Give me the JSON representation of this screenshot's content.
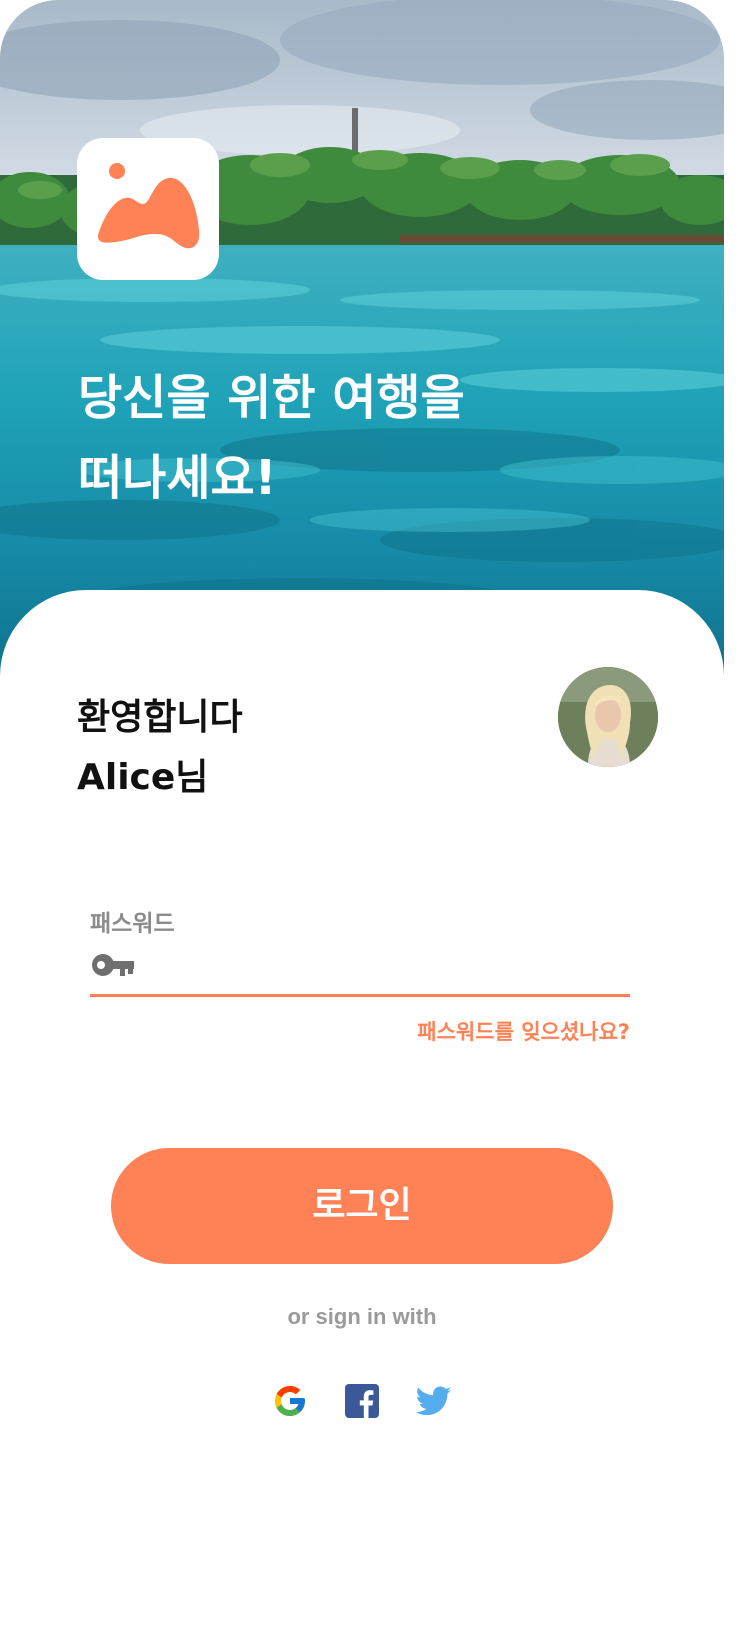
{
  "hero": {
    "title_line1": "당신을 위한 여행을",
    "title_line2": "떠나세요!"
  },
  "welcome": {
    "line1": "환영합니다",
    "line2": "Alice님"
  },
  "password_field": {
    "label": "패스워드",
    "value": "",
    "icon": "key-icon"
  },
  "forgot_password": "패스워드를 잊으셨나요?",
  "login_button": "로그인",
  "or_sign_in_with": "or sign in with",
  "social": [
    {
      "name": "google",
      "icon": "google-icon"
    },
    {
      "name": "facebook",
      "icon": "facebook-icon"
    },
    {
      "name": "twitter",
      "icon": "twitter-icon"
    }
  ],
  "colors": {
    "accent": "#ff8156",
    "label_gray": "#8c8c8c",
    "facebook": "#3b5998",
    "twitter": "#55acee"
  }
}
